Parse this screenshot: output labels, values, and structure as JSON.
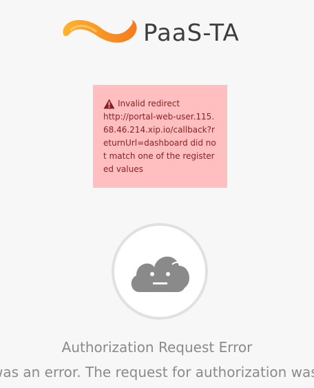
{
  "logo": {
    "text": "PaaS-TA",
    "icon": "paas-ta-logo-swirl"
  },
  "alert": {
    "icon": "warning-triangle-icon",
    "heading": "Invalid redirect",
    "message": "http://portal-web-user.115.68.46.214.xip.io/callback?returnUrl=dashboard did not match one of the registered values"
  },
  "error": {
    "icon": "sad-cloud-icon",
    "title": "Authorization Request Error",
    "description": "was an error. The request for authorization was"
  },
  "colors": {
    "background": "#f7f7f7",
    "alert_bg": "#ffbfc1",
    "alert_text": "#8a1f1f",
    "cloud": "#8a8a8a",
    "logo_orange": "#f7931e"
  }
}
